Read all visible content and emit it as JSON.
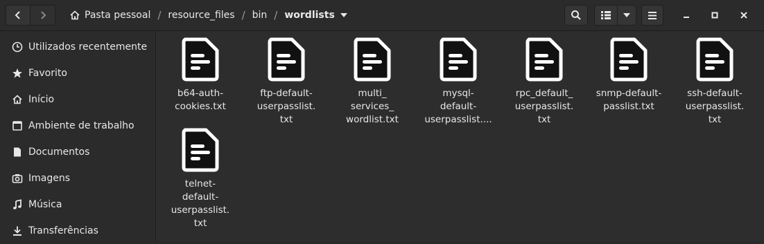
{
  "breadcrumb": {
    "items": [
      {
        "label": "Pasta pessoal"
      },
      {
        "label": "resource_files"
      },
      {
        "label": "bin"
      },
      {
        "label": "wordlists"
      }
    ]
  },
  "sidebar": {
    "items": [
      {
        "label": "Utilizados recentemente",
        "icon": "clock-icon"
      },
      {
        "label": "Favorito",
        "icon": "star-icon"
      },
      {
        "label": "Início",
        "icon": "home-icon"
      },
      {
        "label": "Ambiente de trabalho",
        "icon": "desktop-icon"
      },
      {
        "label": "Documentos",
        "icon": "document-icon"
      },
      {
        "label": "Imagens",
        "icon": "camera-icon"
      },
      {
        "label": "Música",
        "icon": "music-icon"
      },
      {
        "label": "Transferências",
        "icon": "download-icon"
      }
    ]
  },
  "files": [
    {
      "name": "b64-auth-\ncookies.txt"
    },
    {
      "name": "ftp-default-\nuserpasslist.\ntxt"
    },
    {
      "name": "multi_\nservices_\nwordlist.txt"
    },
    {
      "name": "mysql-\ndefault-\nuserpasslist...."
    },
    {
      "name": "rpc_default_\nuserpasslist.\ntxt"
    },
    {
      "name": "snmp-default-\npasslist.txt"
    },
    {
      "name": "ssh-default-\nuserpasslist.\ntxt"
    },
    {
      "name": "telnet-\ndefault-\nuserpasslist.\ntxt"
    }
  ],
  "colors": {
    "background": "#2d2d2d",
    "sidebar": "#2b2b2b",
    "text": "#e8e8e8",
    "file_icon": "#ffffff"
  }
}
